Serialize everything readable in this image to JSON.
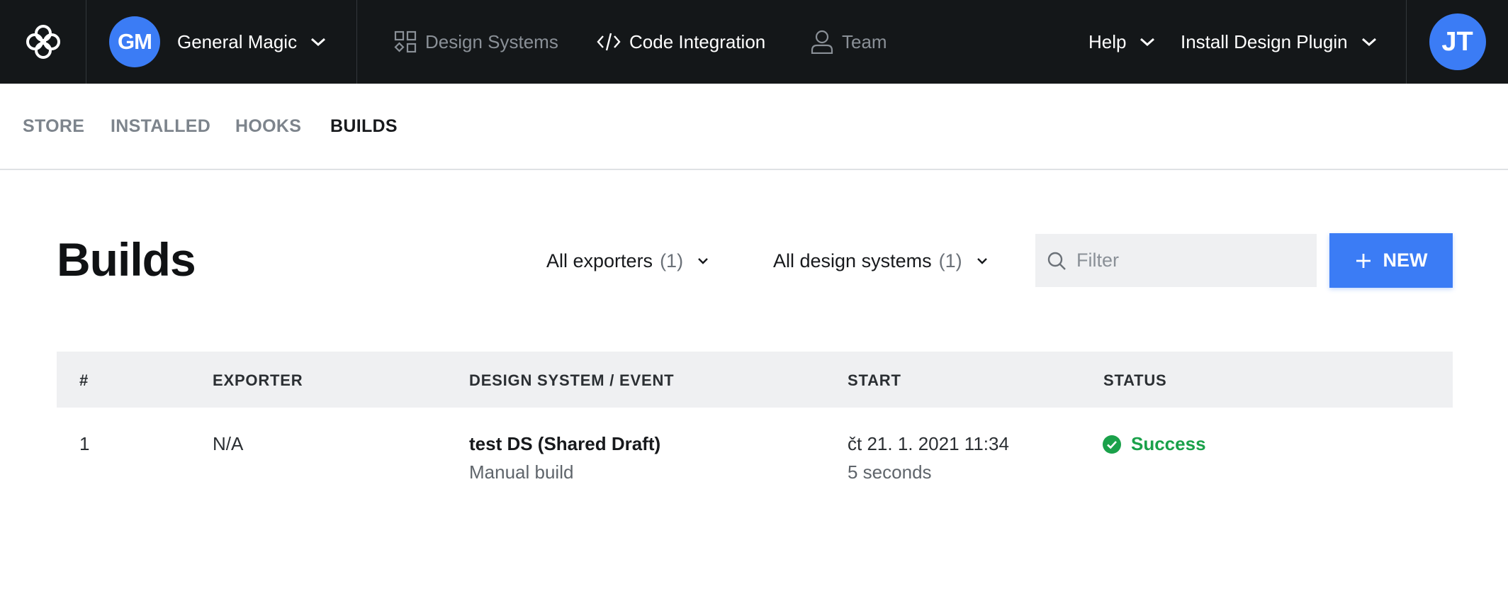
{
  "topbar": {
    "workspace": {
      "initials": "GM",
      "name": "General Magic",
      "avatar_color": "#3b7cf5"
    },
    "nav": [
      {
        "label": "Design Systems",
        "icon": "shapes-icon",
        "active": false
      },
      {
        "label": "Code Integration",
        "icon": "code-icon",
        "active": true
      },
      {
        "label": "Team",
        "icon": "person-icon",
        "active": false
      }
    ],
    "help_label": "Help",
    "install_label": "Install Design Plugin",
    "user_initials": "JT"
  },
  "subtabs": [
    {
      "label": "STORE",
      "active": false
    },
    {
      "label": "INSTALLED",
      "active": false
    },
    {
      "label": "HOOKS",
      "active": false
    },
    {
      "label": "BUILDS",
      "active": true
    }
  ],
  "page": {
    "title": "Builds",
    "exporters_filter": {
      "label": "All exporters",
      "count": "(1)"
    },
    "design_systems_filter": {
      "label": "All design systems",
      "count": "(1)"
    },
    "filter_placeholder": "Filter",
    "new_button_label": "NEW"
  },
  "table": {
    "columns": [
      "#",
      "EXPORTER",
      "DESIGN SYSTEM / EVENT",
      "START",
      "STATUS"
    ],
    "rows": [
      {
        "number": "1",
        "exporter": "N/A",
        "design_system": "test DS (Shared Draft)",
        "event": "Manual build",
        "start": "čt 21. 1. 2021 11:34",
        "duration": "5 seconds",
        "status": "Success",
        "status_color": "#1aa14a"
      }
    ]
  },
  "colors": {
    "accent": "#3b7cf5",
    "topbar_bg": "#141719",
    "success": "#1aa14a"
  }
}
